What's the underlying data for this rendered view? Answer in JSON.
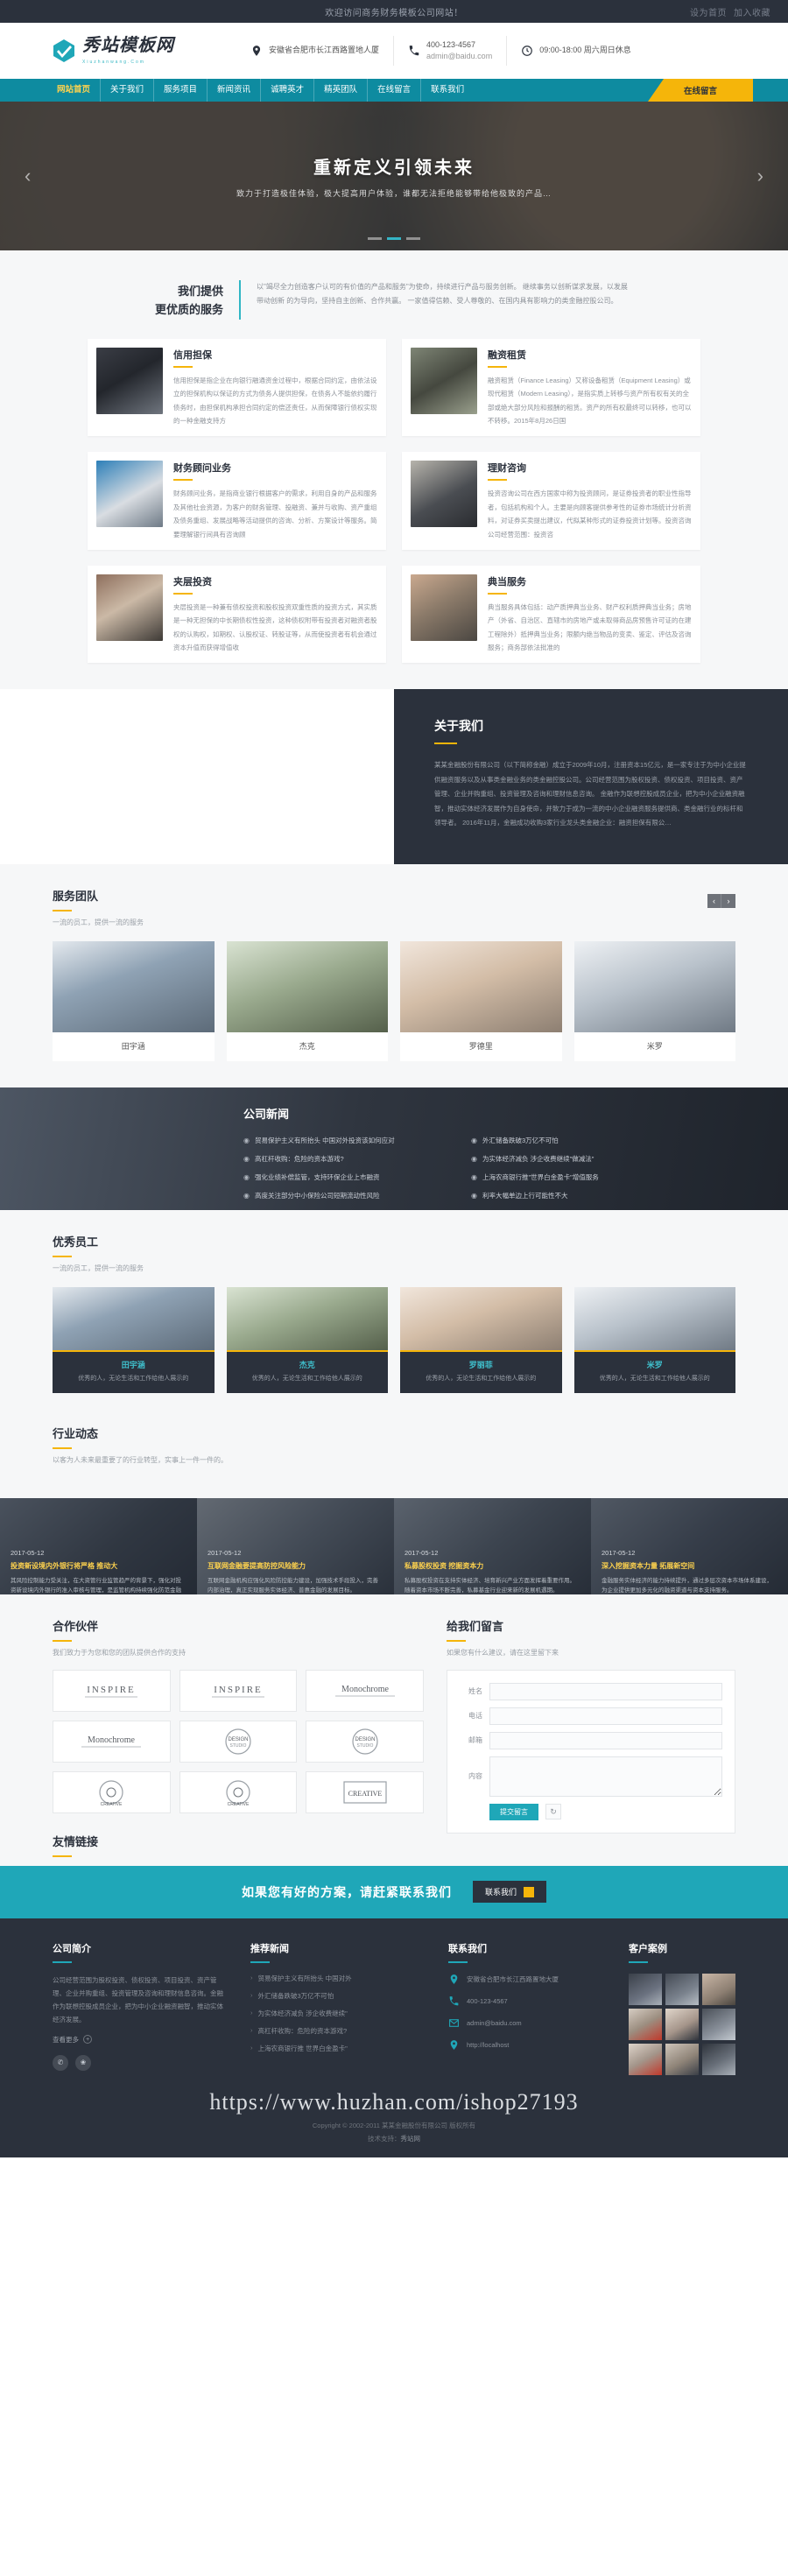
{
  "topbar": {
    "welcome": "欢迎访问商务财务模板公司网站！",
    "right_items": [
      "设为首页",
      "加入收藏"
    ]
  },
  "header": {
    "logo_cn": "秀站模板网",
    "logo_en": "Xiuzhanwang.Com",
    "address_icon": "location-pin-icon",
    "address": "安徽省合肥市长江西路置地人厦",
    "phone_icon": "phone-icon",
    "phone": "400-123-4567",
    "email": "admin@baidu.com",
    "clock_icon": "clock-icon",
    "hours": "09:00-18:00 周六周日休息"
  },
  "nav": {
    "items": [
      {
        "label": "网站首页",
        "active": true
      },
      {
        "label": "关于我们",
        "active": false
      },
      {
        "label": "服务项目",
        "active": false
      },
      {
        "label": "新闻资讯",
        "active": false
      },
      {
        "label": "诚聘英才",
        "active": false
      },
      {
        "label": "精英团队",
        "active": false
      },
      {
        "label": "在线留言",
        "active": false
      },
      {
        "label": "联系我们",
        "active": false
      }
    ],
    "cta": "在线留言"
  },
  "banner": {
    "title": "重新定义引领未来",
    "subtitle": "致力于打造极佳体验，极大提高用户体验，谁都无法拒绝能够带给他极致的产品…",
    "prev_icon": "chevron-left-icon",
    "next_icon": "chevron-right-icon"
  },
  "services": {
    "heading_line1": "我们提供",
    "heading_line2": "更优质的服务",
    "intro": "以\"竭尽全力创造客户认可的有价值的产品和服务\"为使命，持续进行产品与服务创新。 继续事务以创新谋求发展，以发展带动创新 的为导向，坚持自主创新、合作共赢。 一家值得信赖、受人尊敬的、在国内具有影响力的类金融控股公司。",
    "items": [
      {
        "title": "信用担保",
        "desc": "信用担保是指企业在向银行融通资金过程中，根据合同约定，由依法设立的担保机构以保证的方式为债务人提供担保，在债务人不能依约履行债务时，由担保机构承担合同约定的偿还责任，从而保障银行债权实现的一种金融支持方",
        "thumb": "handshake-business-photo"
      },
      {
        "title": "融资租赁",
        "desc": "融资租赁（Finance Leasing）又称设备租赁（Equipment Leasing）或现代租赁（Modern Leasing），是指实质上转移与资产所有权有关的全部或绝大部分风险和报酬的租赁。资产的所有权最终可以转移，也可以不转移。2015年8月26日国",
        "thumb": "money-falling-photo"
      },
      {
        "title": "财务顾问业务",
        "desc": "财务顾问业务，是指商业银行根据客户的需求，利用自身的产品和服务及其他社会资源，为客户的财务管理、投融资、兼并与收购、资产重组及债务重组、发展战略等活动提供的咨询、分析、方案设计等服务。简要理解银行间具有咨询顾",
        "thumb": "credit-card-photo"
      },
      {
        "title": "理财咨询",
        "desc": "投资咨询公司在西方国家中称为投资顾问，是证券投资者的职业性指导者，包括机构和个人。主要是向顾客提供参考性的证券市场统计分析资料，对证券买卖提出建议，代拟某种形式的证券投资计划等。投资咨询公司经营范围：投资咨",
        "thumb": "businessman-stairs-photo"
      },
      {
        "title": "夹层投资",
        "desc": "夹层投资是一种兼有债权投资和股权投资双重性质的投资方式，其实质是一种无担保的中长期债权性投资，这种债权附带有投资者对融资者股权的认购权，如期权、认股权证、转股证等，从而使投资者有机会通过资本升值而获得增值收",
        "thumb": "man-coffee-photo"
      },
      {
        "title": "典当服务",
        "desc": "典当服务具体包括：动产质押典当业务、财产权利质押典当业务；房地产（外省、自治区、直辖市的房地产或未取得商品房预售许可证的在建工程除外）抵押典当业务；限额内绝当物品的变卖、鉴定、评估及咨询服务；商务部依法批准的",
        "thumb": "people-meeting-photo"
      }
    ]
  },
  "about": {
    "title": "关于我们",
    "text": "某某金融股份有限公司（以下简称金融）成立于2009年10月，注册资本15亿元，是一家专注于为中小企业提供融资服务以及从事类金融业务的类金融控股公司。公司经营范围为股权投资、债权投资、项目投资、资产管理、企业并购重组、投资管理及咨询和理财信息咨询。 金融作为联想控股成员企业，把为中小企业融资融智，推动实体经济发展作为自身使命，并致力于成为一流的中小企业融资服务提供商、类金融行业的标杆和领导者。 2016年11月，金融成功收购3家行业龙头类金融企业：融资担保有限公…"
  },
  "team": {
    "title": "服务团队",
    "subtitle": "一流的员工，提供一流的服务",
    "prev_icon": "chevron-left-icon",
    "next_icon": "chevron-right-icon",
    "members": [
      {
        "name": "田宇涵"
      },
      {
        "name": "杰克"
      },
      {
        "name": "罗德里"
      },
      {
        "name": "米罗"
      }
    ]
  },
  "news": {
    "title": "公司新闻",
    "bullet_icon": "arrow-circle-icon",
    "left": [
      "贸易保护主义有所抬头 中国对外投资该如何应对",
      "高杠杆收购：危险的资本游戏?",
      "强化业绩补偿监管，支持环保企业上市融资",
      "高度关注部分中小保险公司短期流动性风险"
    ],
    "right": [
      "外汇储备跌破3万亿不可怕",
      "为实体经济减负 涉企收费继续\"做减法\"",
      "上海农商银行推\"世界白金盈卡\"增值服务",
      "利率大幅单边上行可能性不大"
    ]
  },
  "staff": {
    "title": "优秀员工",
    "subtitle": "一流的员工，提供一流的服务",
    "members": [
      {
        "name": "田宇涵",
        "desc": "优秀的人，无论生活和工作给他人展示的"
      },
      {
        "name": "杰克",
        "desc": "优秀的人，无论生活和工作给他人展示的"
      },
      {
        "name": "罗丽菲",
        "desc": "优秀的人，无论生活和工作给他人展示的"
      },
      {
        "name": "米罗",
        "desc": "优秀的人，无论生活和工作给他人展示的"
      }
    ]
  },
  "industry": {
    "title": "行业动态",
    "subtitle": "以客为人未来最重要了的行业转型，实事上一件一件的。",
    "items": [
      {
        "date": "2017-05-12",
        "title": "投资新设境内外银行将严格 推动大",
        "desc": "其风险控制能力受关注，在大资管行业监管趋严的背景下，强化对投资新设境内外银行的准入审核与管理，是监管机构持续强化防范金融风险的重要一环。"
      },
      {
        "date": "2017-05-12",
        "title": "互联网金融要提高防控风险能力",
        "desc": "互联网金融机构应强化风险防控能力建设，加强技术手段投入，完善内部治理，真正实现服务实体经济、普惠金融的发展目标。"
      },
      {
        "date": "2017-05-12",
        "title": "私募股权投资 挖掘资本力",
        "desc": "私募股权投资在支持实体经济、培育新兴产业方面发挥着重要作用。随着资本市场不断完善，私募基金行业迎来新的发展机遇期。"
      },
      {
        "date": "2017-05-12",
        "title": "深入挖掘资本力量 拓展新空间",
        "desc": "金融服务实体经济的能力持续提升，通过多层次资本市场体系建设，为企业提供更加多元化的融资渠道与资本支持服务。"
      }
    ]
  },
  "partners": {
    "title": "合作伙伴",
    "subtitle": "我们致力于为您和您的团队提供合作的支持",
    "logos": [
      {
        "label": "INSPIRE"
      },
      {
        "label": "INSPIRE"
      },
      {
        "label": "Monochrome"
      },
      {
        "label": "Monochrome"
      },
      {
        "label": "DESIGN STUDIO"
      },
      {
        "label": "DESIGN STUDIO"
      },
      {
        "label": "CREATIVE"
      },
      {
        "label": "CREATIVE"
      },
      {
        "label": "CREATIVE"
      }
    ],
    "friend_links_title": "友情链接"
  },
  "message": {
    "title": "给我们留言",
    "subtitle": "如果您有什么建议，请在这里留下来",
    "fields": [
      {
        "label": "姓名",
        "placeholder": ""
      },
      {
        "label": "电话",
        "placeholder": ""
      },
      {
        "label": "邮箱",
        "placeholder": ""
      },
      {
        "label": "内容",
        "placeholder": ""
      }
    ],
    "submit": "提交留言",
    "reset_icon": "refresh-icon"
  },
  "cta": {
    "text": "如果您有好的方案，请赶紧联系我们",
    "button": "联系我们",
    "button_icon": "arrow-right-icon"
  },
  "footer": {
    "col1": {
      "title": "公司简介",
      "text": "公司经营范围为股权投资、债权投资、项目投资、资产管理、企业并购重组、投资管理及咨询和理财信息咨询。金融作为联想控股成员企业，把为中小企业融资融智，推动实体经济发展。",
      "more": "查看更多",
      "more_icon": "plus-circle-icon",
      "socials": [
        "wechat-icon",
        "weibo-icon"
      ]
    },
    "col2": {
      "title": "推荐新闻",
      "items": [
        "贸易保护主义有所抬头 中国对外",
        "外汇储备跌破3万亿不可怕",
        "为实体经济减负 涉企收费继续\"",
        "高杠杆收购：危险的资本游戏?",
        "上海农商银行推 世界白金盈卡\""
      ]
    },
    "col3": {
      "title": "联系我们",
      "address_icon": "location-pin-icon",
      "address": "安徽省合肥市长江西路置地大厦",
      "phone_icon": "phone-icon",
      "phone": "400-123-4567",
      "email_icon": "mail-icon",
      "email": "admin@baidu.com",
      "site_icon": "globe-icon",
      "site": "http://localhost"
    },
    "col4": {
      "title": "客户案例"
    },
    "watermark": "https://www.huzhan.com/ishop27193",
    "copyright": "Copyright © 2002-2011 某某金融股份有限公司 版权所有",
    "support_label": "技术支持：",
    "support_link": "秀站网"
  }
}
